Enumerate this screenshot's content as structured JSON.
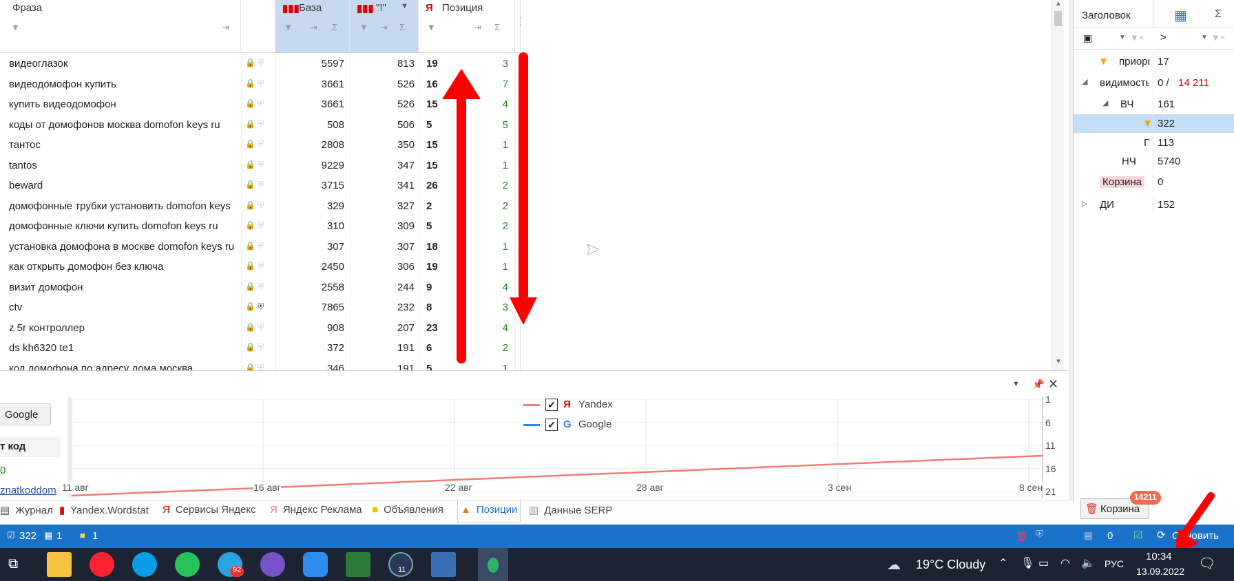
{
  "grid": {
    "col_phrase": "Фраза",
    "col_baza": "База",
    "col_excl": "\"!\"",
    "col_pos": "Позиция",
    "rows": [
      {
        "phrase": "видеоглазок",
        "baza": "5597",
        "excl": "813",
        "pos": "19",
        "chg": "3",
        "red": false
      },
      {
        "phrase": "видеодомофон купить",
        "baza": "3661",
        "excl": "526",
        "pos": "16",
        "chg": "7",
        "red": false
      },
      {
        "phrase": "купить видеодомофон",
        "baza": "3661",
        "excl": "526",
        "pos": "15",
        "chg": "4",
        "red": false
      },
      {
        "phrase": "коды от домофонов москва domofon keys ru",
        "baza": "508",
        "excl": "506",
        "pos": "5",
        "chg": "5",
        "red": false
      },
      {
        "phrase": "тантос",
        "baza": "2808",
        "excl": "350",
        "pos": "15",
        "chg": "1",
        "red": false
      },
      {
        "phrase": "tantos",
        "baza": "9229",
        "excl": "347",
        "pos": "15",
        "chg": "1",
        "red": false
      },
      {
        "phrase": "beward",
        "baza": "3715",
        "excl": "341",
        "pos": "26",
        "chg": "2",
        "red": false
      },
      {
        "phrase": "домофонные трубки установить domofon keys",
        "baza": "329",
        "excl": "327",
        "pos": "2",
        "chg": "2",
        "red": false
      },
      {
        "phrase": "домофонные ключи купить domofon keys ru",
        "baza": "310",
        "excl": "309",
        "pos": "5",
        "chg": "2",
        "red": false
      },
      {
        "phrase": "установка домофона в москве domofon keys ru",
        "baza": "307",
        "excl": "307",
        "pos": "18",
        "chg": "1",
        "red": false
      },
      {
        "phrase": "как открыть домофон без ключа",
        "baza": "2450",
        "excl": "306",
        "pos": "19",
        "chg": "1",
        "red": false
      },
      {
        "phrase": "визит домофон",
        "baza": "2558",
        "excl": "244",
        "pos": "9",
        "chg": "4",
        "red": false
      },
      {
        "phrase": "ctv",
        "baza": "7865",
        "excl": "232",
        "pos": "8",
        "chg": "3",
        "red": false
      },
      {
        "phrase": "z 5r контроллер",
        "baza": "908",
        "excl": "207",
        "pos": "23",
        "chg": "4",
        "red": false
      },
      {
        "phrase": "ds kh6320 te1",
        "baza": "372",
        "excl": "191",
        "pos": "6",
        "chg": "2",
        "red": false
      },
      {
        "phrase": "код домофона по адресу дома москва",
        "baza": "346",
        "excl": "191",
        "pos": "5",
        "chg": "1",
        "red": true
      }
    ]
  },
  "right_panel": {
    "header": "Заголовок",
    "filter_op": ">",
    "rows": [
      {
        "label": "приори",
        "value": "17"
      },
      {
        "label": "видимость",
        "value": "0 / ",
        "value2": "14 211"
      },
      {
        "label": "ВЧ",
        "value": "161"
      },
      {
        "label": "",
        "value": "322"
      },
      {
        "label": "Гу",
        "value": "113"
      },
      {
        "label": "НЧ",
        "value": "5740"
      },
      {
        "label": "Корзина",
        "value": "0"
      },
      {
        "label": "ДИ",
        "value": "152"
      }
    ],
    "basket_label": "Корзина",
    "basket_badge": "14211"
  },
  "chart_data": {
    "type": "line",
    "x_ticks": [
      "11 авг",
      "16 авг",
      "22 авг",
      "28 авг",
      "3 сен",
      "8 сен"
    ],
    "y_ticks": [
      "1",
      "6",
      "11",
      "16",
      "21"
    ],
    "series": [
      {
        "name": "Yandex",
        "color": "#f07d73",
        "checked": true
      },
      {
        "name": "Google",
        "color": "#2b8ae0",
        "checked": true
      }
    ]
  },
  "left_panel": {
    "google_btn": "Google",
    "head": "т код",
    "value": "0",
    "link": "znatkoddom"
  },
  "tabs": [
    "Журнал",
    "Yandex.Wordstat",
    "Сервисы Яндекс",
    "Яндекс Реклама",
    "Объявления",
    "Позиции",
    "Данные SERP"
  ],
  "status": {
    "count1": "322",
    "count2": "1",
    "count3": "1",
    "zero": "0",
    "refresh": "Обновить"
  },
  "taskbar": {
    "weather": "19°C  Cloudy",
    "lang": "РУС",
    "time": "10:34",
    "date": "13.09.2022",
    "telegram_badge": "92",
    "clock_badge": "11"
  }
}
